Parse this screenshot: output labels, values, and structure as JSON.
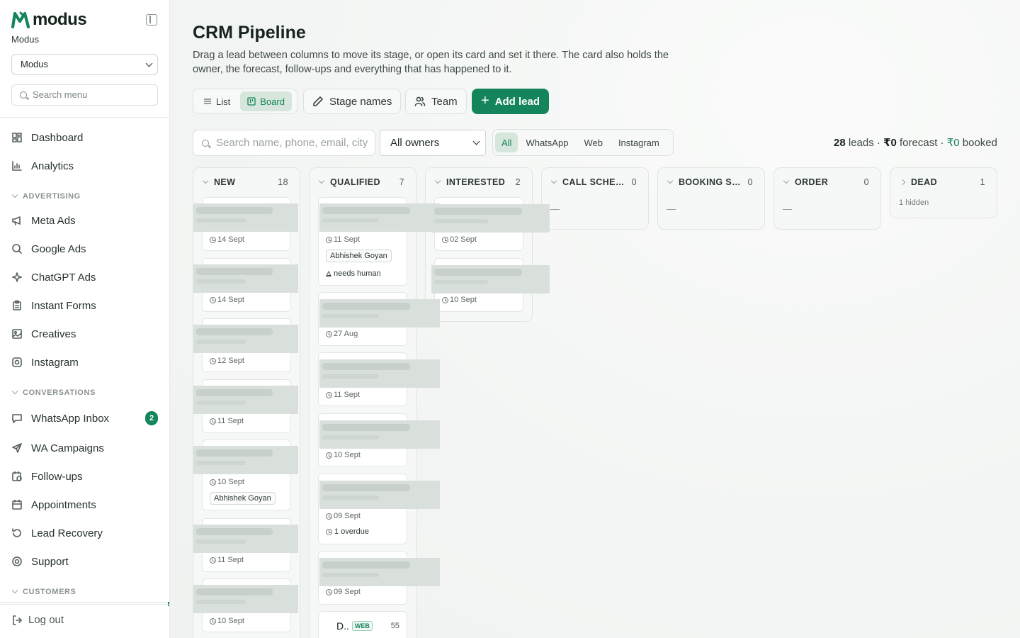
{
  "brand": {
    "name": "modus",
    "org": "Modus",
    "org_select": "Modus"
  },
  "sidebar": {
    "search_placeholder": "Search menu",
    "items": [
      {
        "label": "Dashboard",
        "icon": "dashboard-icon"
      },
      {
        "label": "Analytics",
        "icon": "bar-chart-icon"
      }
    ],
    "sections": [
      {
        "title": "ADVERTISING",
        "items": [
          {
            "label": "Meta Ads",
            "icon": "megaphone-icon"
          },
          {
            "label": "Google Ads",
            "icon": "search-icon"
          },
          {
            "label": "ChatGPT Ads",
            "icon": "sparkle-icon"
          },
          {
            "label": "Instant Forms",
            "icon": "clipboard-icon"
          },
          {
            "label": "Creatives",
            "icon": "image-icon"
          },
          {
            "label": "Instagram",
            "icon": "instagram-icon"
          }
        ]
      },
      {
        "title": "CONVERSATIONS",
        "items": [
          {
            "label": "WhatsApp Inbox",
            "icon": "chat-icon",
            "badge": "2"
          },
          {
            "label": "WA Campaigns",
            "icon": "send-icon"
          },
          {
            "label": "Follow-ups",
            "icon": "calendar-clock-icon"
          },
          {
            "label": "Appointments",
            "icon": "calendar-icon"
          },
          {
            "label": "Lead Recovery",
            "icon": "refresh-icon"
          },
          {
            "label": "Support",
            "icon": "lifebuoy-icon"
          }
        ]
      },
      {
        "title": "CUSTOMERS",
        "items": []
      }
    ],
    "logout": "Log out"
  },
  "page": {
    "title": "CRM Pipeline",
    "description": "Drag a lead between columns to move its stage, or open its card and set it there. The card also holds the owner, the forecast, follow-ups and everything that has happened to it."
  },
  "toolbar": {
    "view_list": "List",
    "view_board": "Board",
    "stage_names": "Stage names",
    "team": "Team",
    "add_lead": "Add lead"
  },
  "filters": {
    "search_placeholder": "Search name, phone, email, city",
    "owner": "All owners",
    "sources": [
      "All",
      "WhatsApp",
      "Web",
      "Instagram"
    ],
    "active_source": "All"
  },
  "summary": {
    "leads_count": "28",
    "leads_label": "leads",
    "sep": "·",
    "forecast_value": "₹0",
    "forecast_label": "forecast",
    "booked_value": "₹0",
    "booked_label": "booked"
  },
  "columns": [
    {
      "name": "NEW",
      "count": "18"
    },
    {
      "name": "QUALIFIED",
      "count": "7"
    },
    {
      "name": "INTERESTED",
      "count": "2"
    },
    {
      "name": "CALL SCHEDULED",
      "count": "0",
      "empty": "—"
    },
    {
      "name": "BOOKING SCHEDULED",
      "count": "0",
      "empty": "—"
    },
    {
      "name": "ORDER",
      "count": "0",
      "empty": "—"
    },
    {
      "name": "DEAD",
      "count": "1",
      "hidden": "1 hidden"
    }
  ],
  "cards": {
    "new": [
      {
        "date": "14 Sept"
      },
      {
        "date": "14 Sept"
      },
      {
        "date": "12 Sept"
      },
      {
        "date": "11 Sept"
      },
      {
        "date": "10 Sept",
        "owner": "Abhishek Goyan"
      },
      {
        "date": "11 Sept"
      },
      {
        "date": "10 Sept"
      }
    ],
    "qualified": [
      {
        "date": "11 Sept",
        "owner": "Abhishek Goyan",
        "flag": "needs human"
      },
      {
        "date": "27 Aug"
      },
      {
        "date": "11 Sept"
      },
      {
        "date": "10 Sept"
      },
      {
        "date": "09 Sept",
        "flag": "1 overdue"
      },
      {
        "date": "09 Sept"
      },
      {
        "name": "D..",
        "tag": "WEB",
        "number": "55"
      }
    ],
    "interested": [
      {
        "date": "02 Sept"
      },
      {
        "date": "10 Sept"
      }
    ]
  }
}
